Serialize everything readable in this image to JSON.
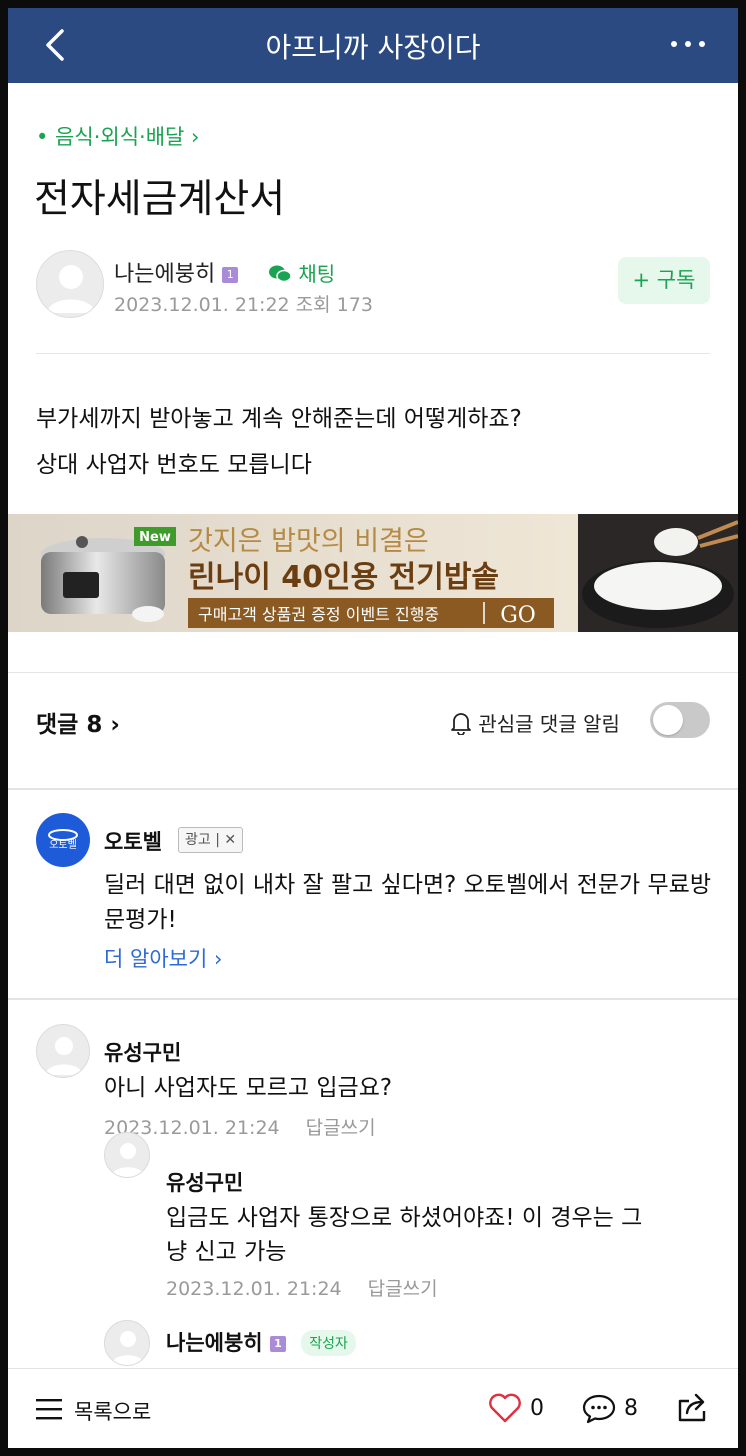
{
  "header": {
    "title": "아프니까 사장이다"
  },
  "post": {
    "category": "• 음식·외식·배달 ›",
    "title": "전자세금계산서",
    "author": "나는에붕히",
    "level": "1",
    "chat_label": "채팅",
    "meta": "2023.12.01. 21:22  조회 173",
    "subscribe_label": "+ 구독",
    "body_line1": "부가세까지 받아놓고 계속 안해준는데 어떻게하죠?",
    "body_line2": "상대 사업자 번호도 모릅니다"
  },
  "banner": {
    "badge": "New",
    "line1": "갓지은 밥맛의 비결은",
    "line2": "린나이 40인용 전기밥솥",
    "line3": "구매고객 상품권 증정 이벤트 진행중",
    "go": "GO"
  },
  "comments": {
    "header": "댓글 8 ›",
    "alarm_label": "관심글 댓글 알림",
    "alarm_on": false
  },
  "ad": {
    "logo_text": "오토벨",
    "name": "오토벨",
    "tag": "광고 | ✕",
    "text": "딜러 대면 없이 내차 잘 팔고 싶다면? 오토벨에서 전문가 무료방문평가!",
    "more": "더 알아보기 ›"
  },
  "comment_list": [
    {
      "name": "유성구민",
      "text": "아니 사업자도 모르고 입금요?",
      "time": "2023.12.01. 21:24",
      "reply": "답글쓰기"
    },
    {
      "name": "유성구민",
      "text_line1": "입금도 사업자 통장으로 하셨어야죠! 이 경우는 그",
      "text_line2": "냥 신고 가능",
      "time": "2023.12.01. 21:24",
      "reply": "답글쓰기"
    },
    {
      "name": "나는에붕히",
      "level": "1",
      "badge": "작성자"
    }
  ],
  "bottom_bar": {
    "list_label": "목록으로",
    "likes": "0",
    "comments": "8"
  },
  "colors": {
    "header_bg": "#2b4a82",
    "accent_green": "#1aa351",
    "link_blue": "#2e6ad3",
    "like_red": "#e0313e"
  }
}
